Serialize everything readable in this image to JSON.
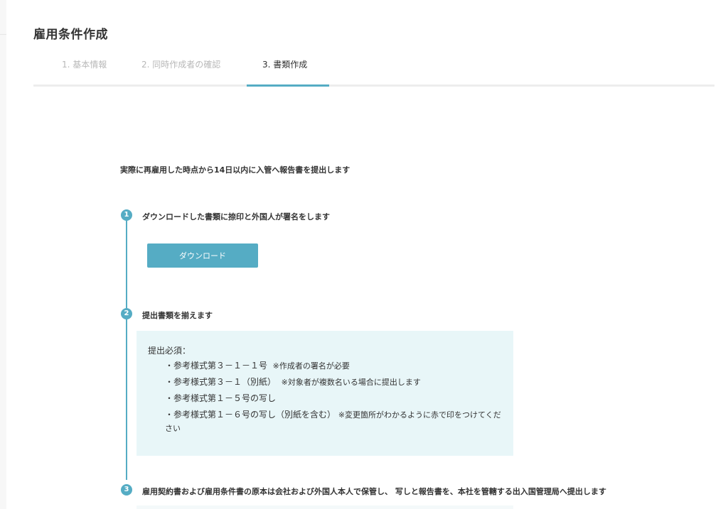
{
  "page": {
    "title": "雇用条件作成"
  },
  "tabs": [
    {
      "label": "1. 基本情報",
      "active": false
    },
    {
      "label": "2. 同時作成者の確認",
      "active": false
    },
    {
      "label": "3. 書類作成",
      "active": true
    }
  ],
  "intro": "実際に再雇用した時点から14日以内に入管へ報告書を提出します",
  "steps": [
    {
      "number": "1",
      "title": "ダウンロードした書類に捺印と外国人が署名をします",
      "button_label": "ダウンロード"
    },
    {
      "number": "2",
      "title": "提出書類を揃えます"
    },
    {
      "number": "3",
      "title": "雇用契約書および雇用条件書の原本は会社および外国人本人で保管し、 写しと報告書を、本社を管轄する出入国管理局へ提出します"
    }
  ],
  "required": {
    "heading": "提出必須：",
    "items": [
      {
        "text": "・参考様式第３－１－１号",
        "note": "※作成者の署名が必要"
      },
      {
        "text": "・参考様式第３－１（別紙）",
        "note": "※対象者が複数名いる場合に提出します"
      },
      {
        "text": "・参考様式第１－５号の写し",
        "note": ""
      },
      {
        "text": "・参考様式第１－６号の写し（別紙を含む）",
        "note": "※変更箇所がわかるように赤で印をつけてください"
      }
    ]
  },
  "colors": {
    "accent": "#55acc4",
    "panel": "#e8f6f8",
    "muted_tab": "#b8b8b8"
  }
}
